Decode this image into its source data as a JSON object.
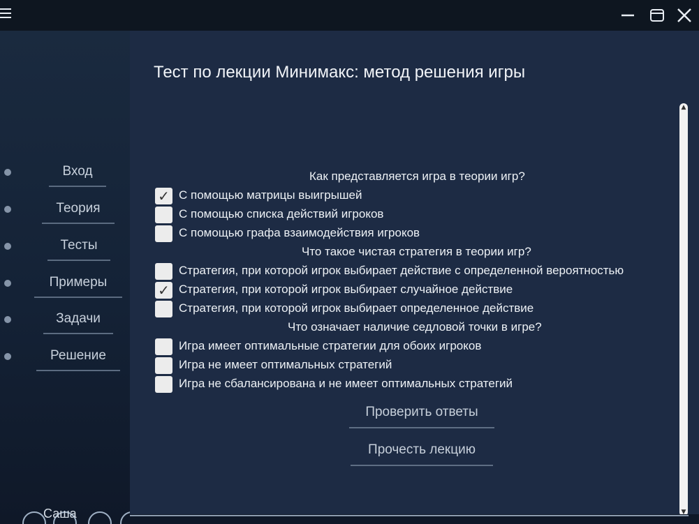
{
  "window": {
    "menu_icon": "hamburger-menu-icon",
    "minimize_icon": "minimize-icon",
    "maximize_icon": "maximize-icon",
    "close_icon": "close-icon"
  },
  "sidebar": {
    "items": [
      {
        "label": "Вход"
      },
      {
        "label": "Теория"
      },
      {
        "label": "Тесты"
      },
      {
        "label": "Примеры"
      },
      {
        "label": "Задачи"
      },
      {
        "label": "Решение"
      }
    ],
    "user_name": "Саша"
  },
  "main": {
    "title": "Тест по лекции Минимакс: метод решения игры",
    "questions": [
      {
        "text": "Как представляется игра в теории игр?",
        "options": [
          {
            "text": "С помощью матрицы выигрышей",
            "checked": true
          },
          {
            "text": "С помощью списка действий игроков",
            "checked": false
          },
          {
            "text": "С помощью графа взаимодействия игроков",
            "checked": false
          }
        ]
      },
      {
        "text": "Что такое чистая стратегия в теории игр?",
        "options": [
          {
            "text": "Стратегия, при которой игрок выбирает действие с определенной вероятностью",
            "checked": false
          },
          {
            "text": "Стратегия, при которой игрок выбирает случайное действие",
            "checked": true
          },
          {
            "text": "Стратегия, при которой игрок выбирает определенное действие",
            "checked": false
          }
        ]
      },
      {
        "text": "Что означает наличие седловой точки в игре?",
        "options": [
          {
            "text": "Игра имеет оптимальные стратегии для обоих игроков",
            "checked": false
          },
          {
            "text": "Игра не имеет оптимальных стратегий",
            "checked": false
          },
          {
            "text": "Игра не сбалансирована и не имеет оптимальных стратегий",
            "checked": false
          }
        ]
      }
    ],
    "check_button": "Проверить ответы",
    "read_button": "Прочесть лекцию"
  },
  "colors": {
    "content_bg": "#1d2b44",
    "sidebar_bg": "#1a2a3f",
    "checkbox_bg": "#ececec"
  }
}
